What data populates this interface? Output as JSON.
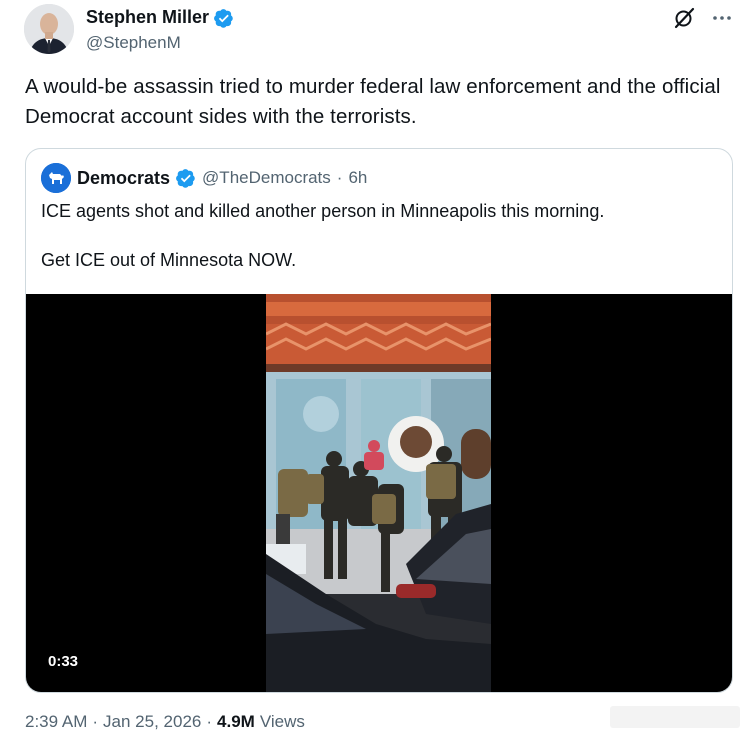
{
  "author": {
    "display_name": "Stephen Miller",
    "handle": "@StephenM"
  },
  "tweet": {
    "text": "A would-be assassin tried to murder federal law enforcement and the official Democrat account sides with the terrorists."
  },
  "quote": {
    "display_name": "Democrats",
    "handle": "@TheDemocrats",
    "separator": "·",
    "time": "6h",
    "line1": "ICE agents shot and killed another person in Minneapolis this morning.",
    "line2": "Get ICE out of Minnesota NOW.",
    "video_duration": "0:33"
  },
  "footer": {
    "time": "2:39 AM",
    "sep1": "·",
    "date": "Jan 25, 2026",
    "sep2": "·",
    "views_count": "4.9M",
    "views_label": "Views"
  },
  "icons": {
    "verified": "verified-badge-icon",
    "grok": "grok-icon",
    "more": "more-icon",
    "democrats_logo": "donkey-logo-icon"
  },
  "colors": {
    "verified": "#1d9bf0",
    "secondary_text": "#536471",
    "border": "#cfd9de",
    "democrats_blue": "#1a6fd8"
  }
}
